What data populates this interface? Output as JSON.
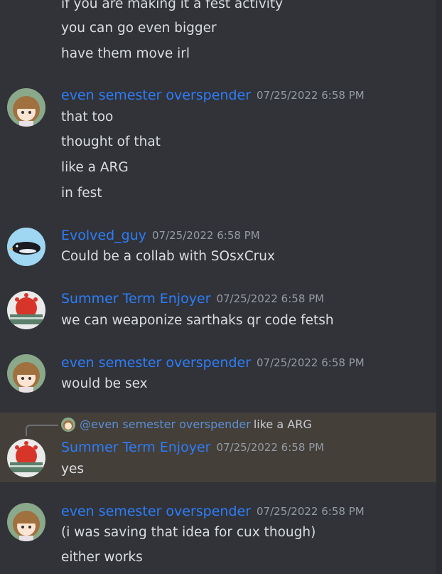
{
  "top_continuation": [
    "if you are making it a fest activity",
    "you can go even bigger",
    "have them move irl"
  ],
  "messages": [
    {
      "user": "even semester overspender",
      "timestamp": "07/25/2022 6:58 PM",
      "avatar": "anime-girl-avatar",
      "lines": [
        "that too",
        "thought of that",
        "like a ARG",
        "in fest"
      ]
    },
    {
      "user": "Evolved_guy",
      "timestamp": "07/25/2022 6:58 PM",
      "avatar": "penguin-avatar",
      "lines": [
        "Could be a collab with SOsxCrux"
      ]
    },
    {
      "user": "Summer Term Enjoyer",
      "timestamp": "07/25/2022 6:58 PM",
      "avatar": "virus-meme-avatar",
      "lines": [
        "we can weaponize sarthaks qr code fetsh"
      ]
    },
    {
      "user": "even semester overspender",
      "timestamp": "07/25/2022 6:58 PM",
      "avatar": "anime-girl-avatar",
      "lines": [
        "would be sex"
      ]
    },
    {
      "user": "Summer Term Enjoyer",
      "timestamp": "07/25/2022 6:58 PM",
      "avatar": "virus-meme-avatar",
      "reply_to": {
        "mention": "@even semester overspender",
        "text": "like a ARG"
      },
      "highlighted": true,
      "lines": [
        "yes"
      ]
    },
    {
      "user": "even semester overspender",
      "timestamp": "07/25/2022 6:58 PM",
      "avatar": "anime-girl-avatar",
      "lines": [
        "(i was saving that idea for cux though)",
        "either works"
      ]
    }
  ],
  "colors": {
    "background": "#313338",
    "username": "#2d7dfa",
    "timestamp": "#949ba4",
    "text": "#dbdee1",
    "highlight": "#443f39"
  }
}
